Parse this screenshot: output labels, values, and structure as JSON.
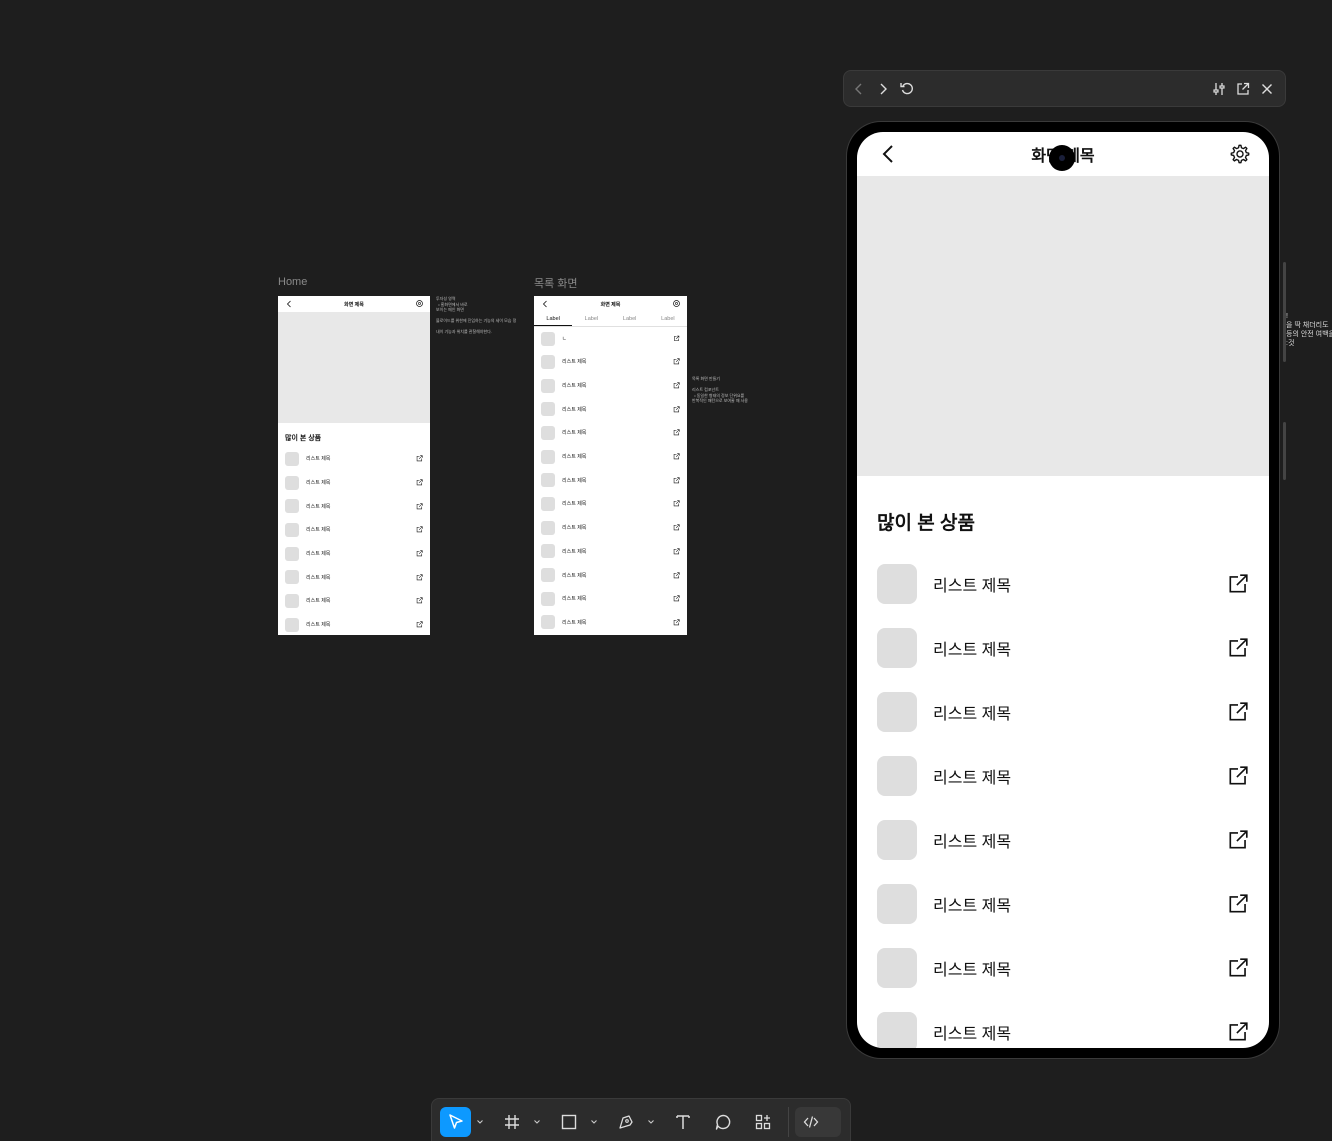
{
  "canvas": {
    "frame_home_label": "Home",
    "frame_list_label": "목록 화면",
    "home_note": "투자성 영역\n  • 홈화면에서 바로\n보이는 메인 화면\n\n블로이드를 위한에 진입하는 기능의 세이 모습 정\n\n내이 기능과 위치를 관찰해야한다.",
    "list_note": "목록 화면 만들기\n\n리스트 컴포넌트\n  • 동일한 형태의 정보 단위요를\n반복적인 패턴으로 보여줄 때 사용",
    "side_note": "!\n을 딱 채더리도\n등의 안전 여백을\n:것"
  },
  "home_frame": {
    "title": "화면 제목",
    "section_title": "많이 본 상품",
    "items": [
      "리스트 제목",
      "리스트 제목",
      "리스트 제목",
      "리스트 제목",
      "리스트 제목",
      "리스트 제목",
      "리스트 제목",
      "리스트 제목"
    ]
  },
  "list_frame": {
    "title": "화면 제목",
    "tabs": [
      "Label",
      "Label",
      "Label",
      "Label"
    ],
    "first_item": "ㄴ",
    "items": [
      "리스트 제목",
      "리스트 제목",
      "리스트 제목",
      "리스트 제목",
      "리스트 제목",
      "리스트 제목",
      "리스트 제목",
      "리스트 제목",
      "리스트 제목",
      "리스트 제목",
      "리스트 제목",
      "리스트 제목"
    ]
  },
  "preview": {
    "title": "화면 제목",
    "section_title": "많이 본 상품",
    "items": [
      "리스트 제목",
      "리스트 제목",
      "리스트 제목",
      "리스트 제목",
      "리스트 제목",
      "리스트 제목",
      "리스트 제목",
      "리스트 제목"
    ]
  },
  "icons": {
    "preview_bar": [
      "chevron-left-icon",
      "chevron-right-icon",
      "reload-icon",
      "settings-sliders-icon",
      "open-external-icon",
      "close-icon"
    ],
    "toolbar": [
      "move-tool-icon",
      "frame-tool-icon",
      "rectangle-tool-icon",
      "pen-tool-icon",
      "text-tool-icon",
      "comment-tool-icon",
      "actions-icon",
      "dev-mode-icon"
    ]
  },
  "colors": {
    "canvas": "#1e1e1e",
    "accent": "#0d99ff",
    "placeholder": "#e8e8e8",
    "thumb": "#dedede"
  }
}
